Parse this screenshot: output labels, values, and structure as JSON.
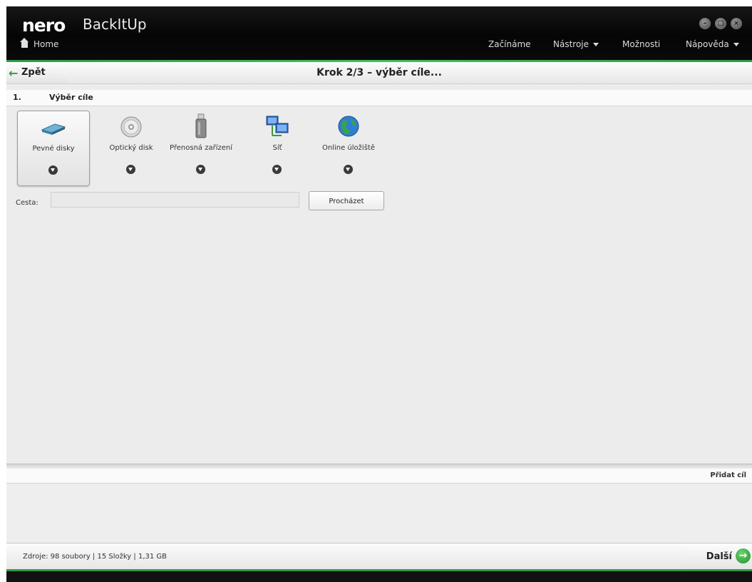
{
  "app": {
    "brand": "nero",
    "product": "BackItUp"
  },
  "titlebar": {
    "home_label": "Home",
    "menu": [
      {
        "label": "Začínáme",
        "dropdown": false
      },
      {
        "label": "Nástroje",
        "dropdown": true
      },
      {
        "label": "Možnosti",
        "dropdown": false
      },
      {
        "label": "Nápověda",
        "dropdown": true
      }
    ]
  },
  "nav": {
    "back_label": "Zpět",
    "step_title": "Krok 2/3 – výběr cíle..."
  },
  "section": {
    "number": "1.",
    "title": "Výběr cíle"
  },
  "targets": [
    {
      "label": "Pevné disky",
      "icon": "hard-disk-icon",
      "selected": true
    },
    {
      "label": "Optický disk",
      "icon": "optical-disc-icon",
      "selected": false
    },
    {
      "label": "Přenosná zařízení",
      "icon": "usb-drive-icon",
      "selected": false
    },
    {
      "label": "Síť",
      "icon": "network-icon",
      "selected": false
    },
    {
      "label": "Online úložiště",
      "icon": "globe-icon",
      "selected": false
    }
  ],
  "path": {
    "label": "Cesta:",
    "value": "",
    "browse_label": "Procházet"
  },
  "add_target_label": "Přidat cíl",
  "status": {
    "text": "Zdroje: 98  soubory | 15 Složky | 1,31 GB",
    "next_label": "Další"
  },
  "colors": {
    "accent_green": "#2f9a45",
    "titlebar": "#0a0a0a"
  }
}
